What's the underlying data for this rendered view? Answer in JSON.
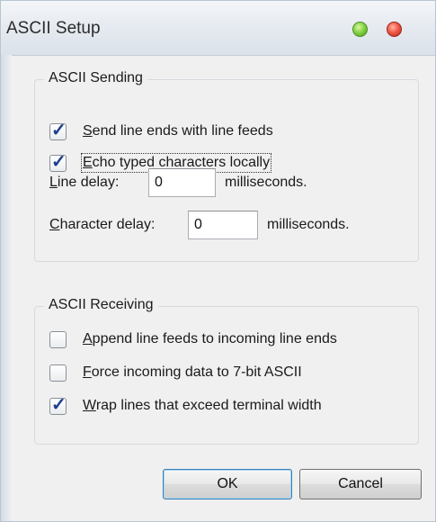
{
  "window": {
    "title": "ASCII Setup"
  },
  "sending": {
    "legend": "ASCII Sending",
    "send_line_ends": {
      "label_key": "S",
      "label_rest": "end line ends with line feeds",
      "checked": true
    },
    "echo_typed": {
      "label_key": "E",
      "label_rest": "cho typed characters locally",
      "checked": true
    },
    "line_delay": {
      "label_key": "L",
      "label_rest": "ine delay:",
      "value": "0",
      "unit": "milliseconds."
    },
    "char_delay": {
      "label_key": "C",
      "label_rest": "haracter delay:",
      "value": "0",
      "unit": "milliseconds."
    }
  },
  "receiving": {
    "legend": "ASCII Receiving",
    "append_line_feeds": {
      "label_key": "A",
      "label_rest": "ppend line feeds to incoming line ends",
      "checked": false
    },
    "force_7bit": {
      "label_key": "F",
      "label_rest": "orce incoming data to 7-bit ASCII",
      "checked": false
    },
    "wrap_lines": {
      "label_key": "W",
      "label_rest": "rap lines that exceed terminal width",
      "checked": true
    }
  },
  "buttons": {
    "ok": "OK",
    "cancel": "Cancel"
  },
  "icons": {
    "check": "checkmark-icon",
    "maximize": "green-circle-icon",
    "close": "red-circle-icon"
  },
  "colors": {
    "titlebar": "#e5eaf0",
    "body": "#f0f0f0",
    "check": "#1d3d8f",
    "close": "#f05a48",
    "maximize": "#86d444"
  }
}
